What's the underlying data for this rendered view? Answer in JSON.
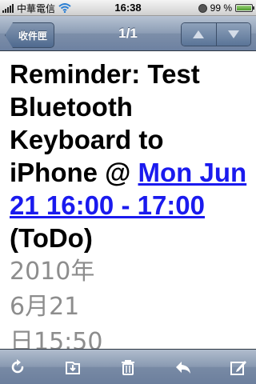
{
  "status_bar": {
    "carrier": "中華電信",
    "time": "16:38",
    "battery_percent": "99 %",
    "battery_level": 0.99
  },
  "nav": {
    "back_label": "收件匣",
    "title": "1/1",
    "prev_icon": "up-arrow",
    "next_icon": "down-arrow"
  },
  "message": {
    "subject_prefix": "Reminder: Test Bluetooth Keyboard to iPhone @ ",
    "subject_link": "Mon Jun 21 16:00 - 17:00",
    "subject_suffix": " (ToDo)",
    "date_lines": [
      "2010年",
      "6月21",
      "日15:50"
    ]
  },
  "toolbar": {
    "icons": [
      "refresh-icon",
      "move-to-folder-icon",
      "trash-icon",
      "reply-icon",
      "compose-icon"
    ]
  },
  "colors": {
    "nav_bar": "#7d8fa9",
    "link": "#1a1aee",
    "date_text": "#8d8d8d"
  }
}
